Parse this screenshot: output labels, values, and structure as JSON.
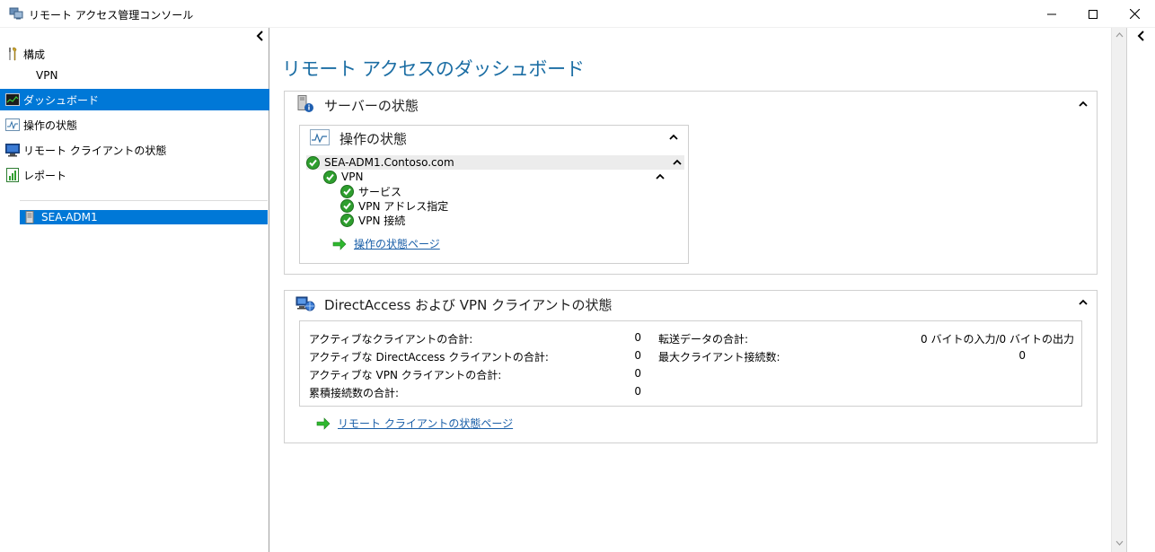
{
  "window": {
    "title": "リモート アクセス管理コンソール"
  },
  "nav": {
    "config_label": "構成",
    "vpn_label": "VPN",
    "items": [
      {
        "label": "ダッシュボード",
        "selected": true
      },
      {
        "label": "操作の状態"
      },
      {
        "label": "リモート クライアントの状態"
      },
      {
        "label": "レポート"
      }
    ],
    "server": "SEA-ADM1"
  },
  "main": {
    "title": "リモート アクセスのダッシュボード",
    "server_status": {
      "title": "サーバーの状態",
      "operations": {
        "title": "操作の状態",
        "server_name": "SEA-ADM1.Contoso.com",
        "vpn": "VPN",
        "children": [
          "サービス",
          "VPN アドレス指定",
          "VPN 接続"
        ],
        "link": "操作の状態ページ"
      }
    },
    "client_status": {
      "title": "DirectAccess および VPN クライアントの状態",
      "stats_left": [
        {
          "label": "アクティブなクライアントの合計:",
          "value": "0"
        },
        {
          "label": "アクティブな DirectAccess クライアントの合計:",
          "value": "0"
        },
        {
          "label": "アクティブな VPN クライアントの合計:",
          "value": "0"
        },
        {
          "label": "累積接続数の合計:",
          "value": "0"
        }
      ],
      "stats_right": [
        {
          "label": "転送データの合計:",
          "value": "0 バイトの入力/0 バイトの出力"
        },
        {
          "label": "最大クライアント接続数:",
          "value": "0"
        }
      ],
      "link": "リモート クライアントの状態ページ"
    }
  },
  "colors": {
    "accent": "#0078d7",
    "title_blue": "#1c6ea4",
    "link_blue": "#1a5fa8",
    "ok_green": "#2e9e2e"
  }
}
